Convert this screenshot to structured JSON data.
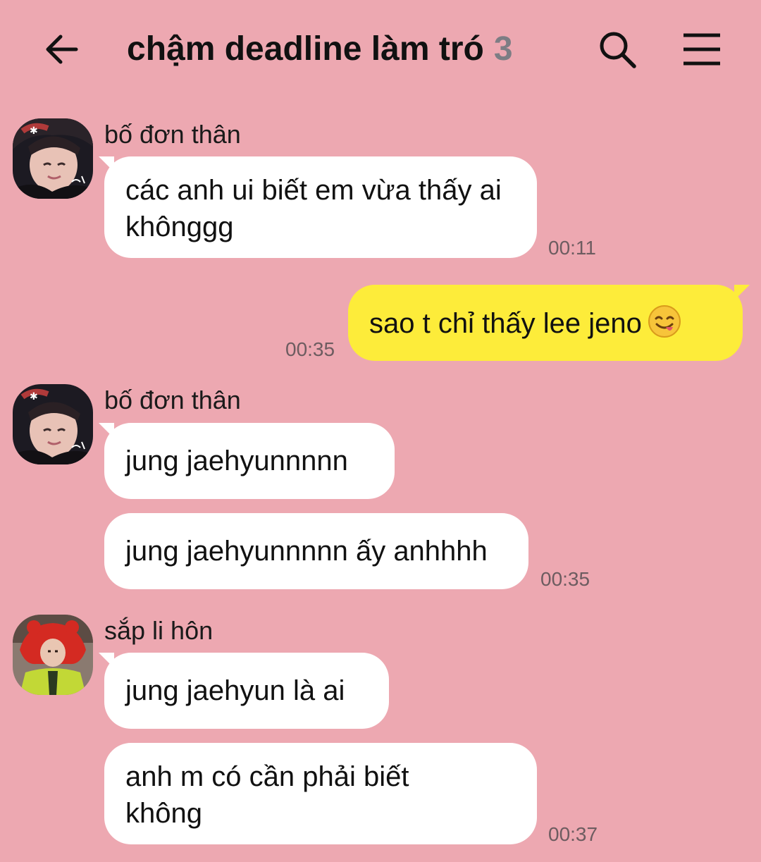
{
  "header": {
    "back_icon": "arrow-left-icon",
    "title": "chậm deadline làm tró",
    "member_count": "3",
    "search_icon": "search-icon",
    "menu_icon": "hamburger-menu-icon"
  },
  "colors": {
    "background": "#eda8b1",
    "incoming_bubble": "#ffffff",
    "outgoing_bubble": "#fdec3a",
    "member_count": "#7d7d84"
  },
  "messages": [
    {
      "sender": "bố đơn thân",
      "text": "các anh ui biết em vừa thấy ai khônggg",
      "time": "00:11"
    },
    {
      "sender": "me",
      "text": "sao t chỉ thấy lee jeno",
      "emoji": "face-savoring-food-icon",
      "time": "00:35"
    },
    {
      "sender": "bố đơn thân",
      "text": "jung jaehyunnnnn",
      "time": ""
    },
    {
      "sender": "bố đơn thân",
      "text": "jung jaehyunnnnn ấy anhhhh",
      "time": "00:35"
    },
    {
      "sender": "sắp li hôn",
      "text": "jung jaehyun là ai",
      "time": ""
    },
    {
      "sender": "sắp li hôn",
      "text": "anh m có cần phải biết không",
      "time": "00:37"
    }
  ]
}
